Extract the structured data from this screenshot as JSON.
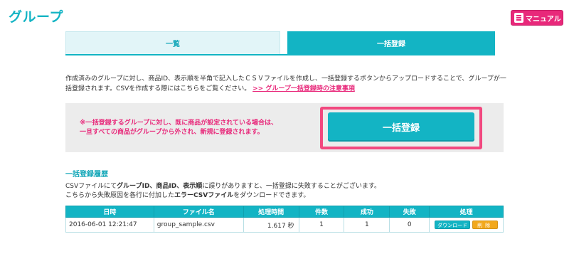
{
  "page": {
    "title": "グループ"
  },
  "header": {
    "manual_label": "マニュアル",
    "manual_icon": "book-icon"
  },
  "tabs": [
    {
      "label": "一覧",
      "active": false
    },
    {
      "label": "一括登録",
      "active": true
    }
  ],
  "description": {
    "text": "作成済みのグループに対し、商品ID、表示順を半角で記入したＣＳＶファイルを作成し、一括登録するボタンからアップロードすることで、グループが一括登録されます。CSVを作成する際にはこちらをご覧ください。",
    "link": ">> グループ一括登録時の注意事項"
  },
  "upload_panel": {
    "warning_line1": "※一括登録するグループに対し、既に商品が設定されている場合は、",
    "warning_line2": "一旦すべての商品がグループから外され、新規に登録されます。",
    "button_label": "一括登録"
  },
  "history": {
    "title": "一括登録履歴",
    "desc_line1_a": "CSVファイルにて",
    "desc_line1_b": "グループID、商品ID、表示順",
    "desc_line1_c": "に誤りがありますと、一括登録に失敗することがございます。",
    "desc_line2_a": "こちらから失敗原因を各行に付加した",
    "desc_line2_b": "エラーCSVファイル",
    "desc_line2_c": "をダウンロードできます。",
    "columns": [
      "日時",
      "ファイル名",
      "処理時間",
      "件数",
      "成功",
      "失敗",
      "処理"
    ],
    "rows": [
      {
        "date": "2016-06-01 12:21:47",
        "file": "group_sample.csv",
        "time": "1.617 秒",
        "count": "1",
        "success": "1",
        "failure": "0",
        "download_label": "ダウンロード",
        "delete_label": "削除"
      }
    ]
  },
  "colors": {
    "accent": "#13b4c4",
    "highlight": "#e8287a",
    "delete": "#f2a81c"
  }
}
